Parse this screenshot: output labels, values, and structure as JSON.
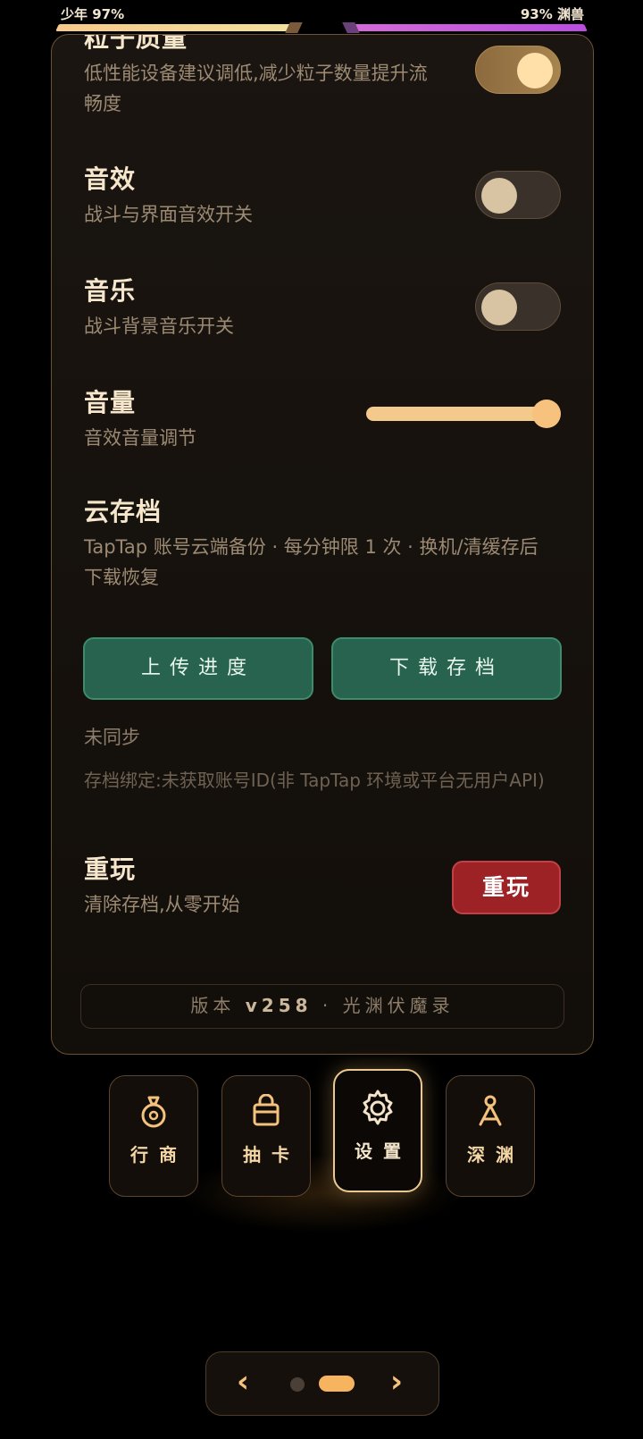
{
  "topbar": {
    "left_label": "少年  97%",
    "right_label": "93%  渊兽",
    "left_percent": 97,
    "right_percent": 93
  },
  "settings": {
    "particles": {
      "title": "粒子质量",
      "desc": "低性能设备建议调低,减少粒子数量提升流畅度",
      "on": true
    },
    "sfx": {
      "title": "音效",
      "desc": "战斗与界面音效开关",
      "on": false
    },
    "music": {
      "title": "音乐",
      "desc": "战斗背景音乐开关",
      "on": false
    },
    "volume": {
      "title": "音量",
      "desc": "音效音量调节",
      "value_percent": 100
    },
    "cloud": {
      "title": "云存档",
      "desc": "TapTap 账号云端备份 · 每分钟限 1 次 · 换机/清缓存后下载恢复",
      "upload_label": "上传进度",
      "download_label": "下载存档",
      "sync_status": "未同步",
      "bind_status": "存档绑定:未获取账号ID(非 TapTap 环境或平台无用户API)"
    },
    "replay": {
      "title": "重玩",
      "desc": "清除存档,从零开始",
      "button_label": "重玩"
    },
    "version": {
      "prefix": "版本",
      "number": "v258",
      "suffix": "· 光渊伏魔录"
    }
  },
  "nav": {
    "items": [
      {
        "label": "行商",
        "icon": "money-bag-icon",
        "active": false
      },
      {
        "label": "抽卡",
        "icon": "gift-box-icon",
        "active": false
      },
      {
        "label": "设置",
        "icon": "gear-icon",
        "active": true
      },
      {
        "label": "深渊",
        "icon": "abyss-icon",
        "active": false
      }
    ]
  },
  "pager": {
    "prev": "‹",
    "next": "›",
    "current_page": 2,
    "total_pages": 2
  },
  "colors": {
    "accent": "#f7b45f",
    "green_button": "#27634e",
    "red_button": "#9c2226",
    "panel_border": "#6b5236"
  }
}
